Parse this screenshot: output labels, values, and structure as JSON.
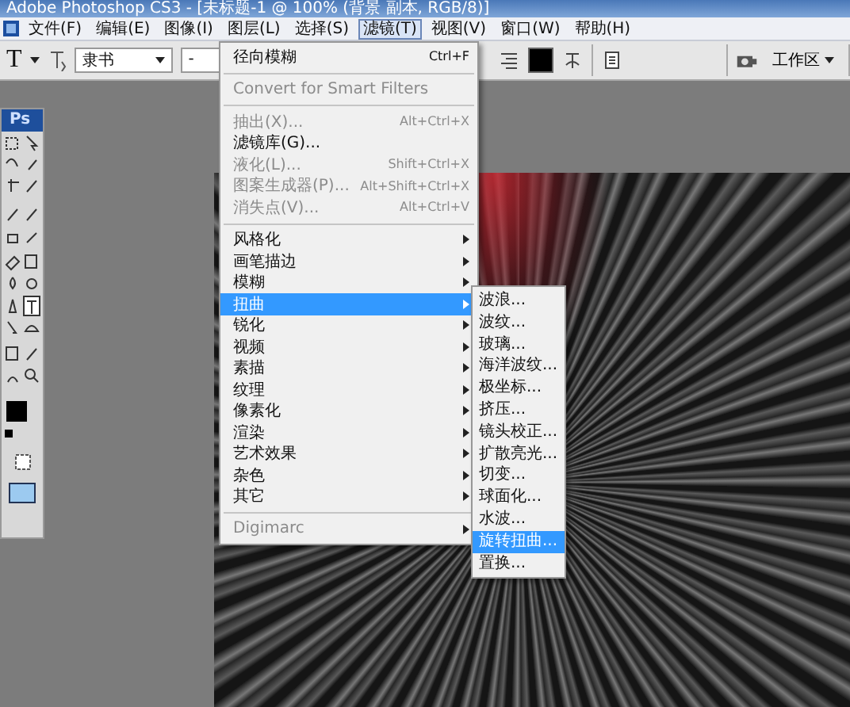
{
  "window": {
    "title": "Adobe Photoshop CS3 - [未标题-1 @ 100% (背景 副本, RGB/8)]"
  },
  "menubar": [
    {
      "label": "文件(F)",
      "selected": false
    },
    {
      "label": "编辑(E)",
      "selected": false
    },
    {
      "label": "图像(I)",
      "selected": false
    },
    {
      "label": "图层(L)",
      "selected": false
    },
    {
      "label": "选择(S)",
      "selected": false
    },
    {
      "label": "滤镜(T)",
      "selected": true
    },
    {
      "label": "视图(V)",
      "selected": false
    },
    {
      "label": "窗口(W)",
      "selected": false
    },
    {
      "label": "帮助(H)",
      "selected": false
    }
  ],
  "options_bar": {
    "tool_glyph": "T",
    "font_family": "隶书",
    "font_size": "-",
    "workspace": "工作区"
  },
  "toolbox": {
    "logo": "Ps"
  },
  "filter_menu": {
    "sections": [
      [
        {
          "label": "径向模糊",
          "shortcut": "Ctrl+F",
          "disabled": false,
          "submenu": false,
          "selected": false
        }
      ],
      [
        {
          "label": "Convert for Smart Filters",
          "disabled": true,
          "submenu": false,
          "selected": false
        }
      ],
      [
        {
          "label": "抽出(X)...",
          "shortcut": "Alt+Ctrl+X",
          "disabled": true,
          "submenu": false,
          "selected": false
        },
        {
          "label": "滤镜库(G)...",
          "disabled": false,
          "submenu": false,
          "selected": false
        },
        {
          "label": "液化(L)...",
          "shortcut": "Shift+Ctrl+X",
          "disabled": true,
          "submenu": false,
          "selected": false
        },
        {
          "label": "图案生成器(P)...",
          "shortcut": "Alt+Shift+Ctrl+X",
          "disabled": true,
          "submenu": false,
          "selected": false
        },
        {
          "label": "消失点(V)...",
          "shortcut": "Alt+Ctrl+V",
          "disabled": true,
          "submenu": false,
          "selected": false
        }
      ],
      [
        {
          "label": "风格化",
          "disabled": false,
          "submenu": true,
          "selected": false
        },
        {
          "label": "画笔描边",
          "disabled": false,
          "submenu": true,
          "selected": false
        },
        {
          "label": "模糊",
          "disabled": false,
          "submenu": true,
          "selected": false
        },
        {
          "label": "扭曲",
          "disabled": false,
          "submenu": true,
          "selected": true
        },
        {
          "label": "锐化",
          "disabled": false,
          "submenu": true,
          "selected": false
        },
        {
          "label": "视频",
          "disabled": false,
          "submenu": true,
          "selected": false
        },
        {
          "label": "素描",
          "disabled": false,
          "submenu": true,
          "selected": false
        },
        {
          "label": "纹理",
          "disabled": false,
          "submenu": true,
          "selected": false
        },
        {
          "label": "像素化",
          "disabled": false,
          "submenu": true,
          "selected": false
        },
        {
          "label": "渲染",
          "disabled": false,
          "submenu": true,
          "selected": false
        },
        {
          "label": "艺术效果",
          "disabled": false,
          "submenu": true,
          "selected": false
        },
        {
          "label": "杂色",
          "disabled": false,
          "submenu": true,
          "selected": false
        },
        {
          "label": "其它",
          "disabled": false,
          "submenu": true,
          "selected": false
        }
      ],
      [
        {
          "label": "Digimarc",
          "disabled": true,
          "submenu": true,
          "selected": false
        }
      ]
    ]
  },
  "distort_submenu": [
    {
      "label": "波浪...",
      "selected": false
    },
    {
      "label": "波纹...",
      "selected": false
    },
    {
      "label": "玻璃...",
      "selected": false
    },
    {
      "label": "海洋波纹...",
      "selected": false
    },
    {
      "label": "极坐标...",
      "selected": false
    },
    {
      "label": "挤压...",
      "selected": false
    },
    {
      "label": "镜头校正...",
      "selected": false
    },
    {
      "label": "扩散亮光...",
      "selected": false
    },
    {
      "label": "切变...",
      "selected": false
    },
    {
      "label": "球面化...",
      "selected": false
    },
    {
      "label": "水波...",
      "selected": false
    },
    {
      "label": "旋转扭曲...",
      "selected": true
    },
    {
      "label": "置换...",
      "selected": false
    }
  ]
}
